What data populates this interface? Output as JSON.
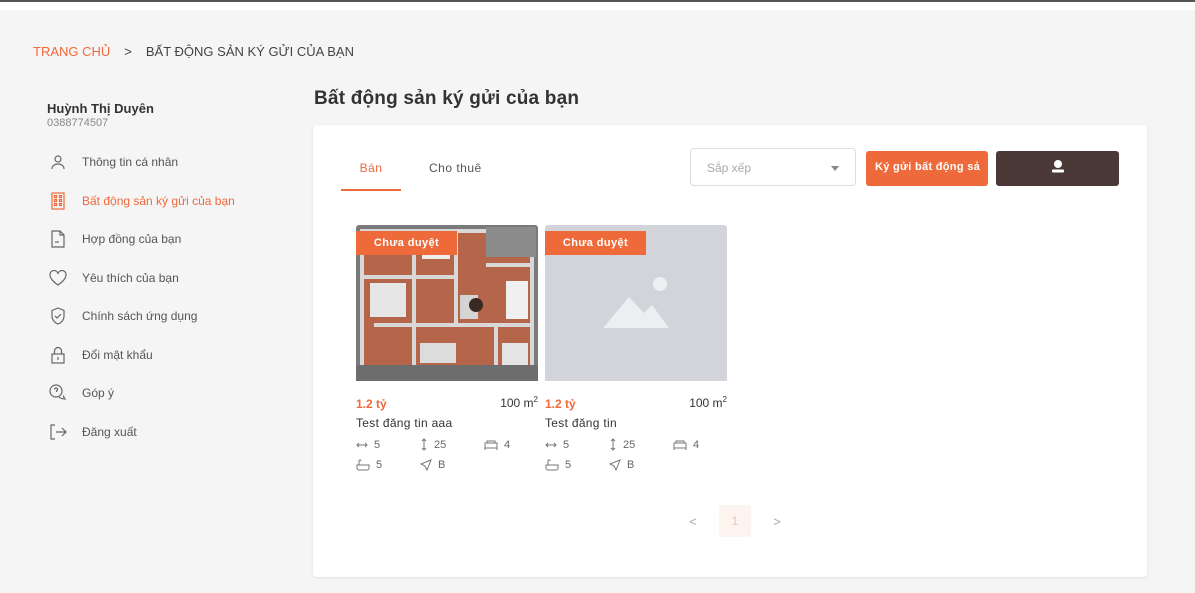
{
  "breadcrumb": {
    "home": "TRANG CHỦ",
    "separator": ">",
    "current": "BẤT ĐỘNG SẢN KÝ GỬI CỦA BẠN"
  },
  "profile": {
    "name": "Huỳnh Thị Duyên",
    "phone": "0388774507"
  },
  "menu": [
    {
      "label": "Thông tin cá nhân",
      "icon": "user-icon",
      "active": false
    },
    {
      "label": "Bất động sản ký gửi của bạn",
      "icon": "building-icon",
      "active": true
    },
    {
      "label": "Hợp đồng của bạn",
      "icon": "document-icon",
      "active": false
    },
    {
      "label": "Yêu thích của bạn",
      "icon": "heart-icon",
      "active": false
    },
    {
      "label": "Chính sách ứng dụng",
      "icon": "shield-icon",
      "active": false
    },
    {
      "label": "Đổi mật khẩu",
      "icon": "lock-icon",
      "active": false
    },
    {
      "label": "Góp ý",
      "icon": "feedback-icon",
      "active": false
    },
    {
      "label": "Đăng xuất",
      "icon": "logout-icon",
      "active": false
    }
  ],
  "page": {
    "title": "Bất động sản ký gửi của bạn"
  },
  "tabs": [
    {
      "label": "Bán",
      "active": true
    },
    {
      "label": "Cho thuê",
      "active": false
    }
  ],
  "sort": {
    "placeholder": "Sắp xếp"
  },
  "consign_button": "Ký gửi bất động sả",
  "listings": [
    {
      "badge": "Chưa duyệt",
      "price": "1.2 tỷ",
      "area": "100 m",
      "area_unit_sup": "2",
      "title": "Test đăng tin aaa",
      "width": "5",
      "length": "25",
      "bedrooms": "4",
      "bathrooms": "5",
      "direction": "B",
      "image": "floorplan"
    },
    {
      "badge": "Chưa duyệt",
      "price": "1.2 tỷ",
      "area": "100 m",
      "area_unit_sup": "2",
      "title": "Test đăng tin",
      "width": "5",
      "length": "25",
      "bedrooms": "4",
      "bathrooms": "5",
      "direction": "B",
      "image": "placeholder"
    }
  ],
  "pagination": {
    "prev": "<",
    "current": "1",
    "next": ">"
  },
  "colors": {
    "accent": "#ef6a3a",
    "dark_button": "#4a3936",
    "background": "#f5f5f5"
  }
}
